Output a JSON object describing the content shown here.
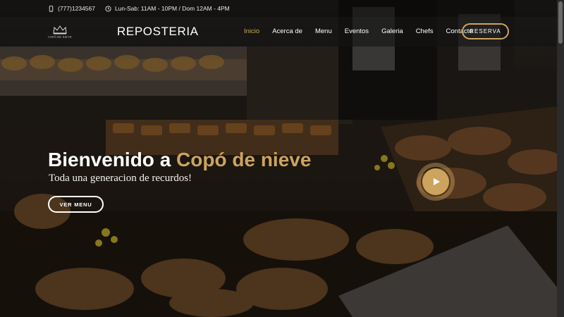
{
  "topbar": {
    "phone": "(777)1234567",
    "hours": "Lun-Sab: 11AM - 10PM / Dom 12AM - 4PM"
  },
  "header": {
    "logo_text": "COPÓ DE NIEVE",
    "brand": "REPOSTERIA",
    "nav": [
      "Inicio",
      "Acerca de",
      "Menu",
      "Eventos",
      "Galeria",
      "Chefs",
      "Contacto"
    ],
    "active_nav": "Inicio",
    "reserve_label": "RESERVA"
  },
  "hero": {
    "title_prefix": "Bienvenido a ",
    "title_accent": "Copó de nieve",
    "subtitle": "Toda una generacion de recurdos!",
    "menu_button": "VER MENU"
  },
  "colors": {
    "accent": "#cda45e",
    "text": "#ffffff"
  },
  "icons": {
    "phone": "phone-icon",
    "clock": "clock-icon",
    "play": "play-icon",
    "logo": "crown-logo-icon"
  }
}
